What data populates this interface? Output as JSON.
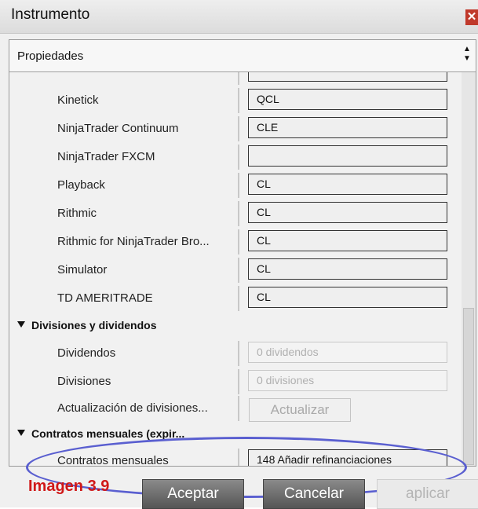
{
  "window": {
    "title": "Instrumento",
    "close_icon": "close-icon"
  },
  "panel": {
    "header": "Propiedades"
  },
  "rows": [
    {
      "label": "Kinetick",
      "value": "QCL"
    },
    {
      "label": "NinjaTrader Continuum",
      "value": "CLE"
    },
    {
      "label": "NinjaTrader FXCM",
      "value": ""
    },
    {
      "label": "Playback",
      "value": "CL"
    },
    {
      "label": "Rithmic",
      "value": "CL"
    },
    {
      "label": "Rithmic for NinjaTrader Bro...",
      "value": "CL"
    },
    {
      "label": "Simulator",
      "value": "CL"
    },
    {
      "label": "TD AMERITRADE",
      "value": "CL"
    }
  ],
  "divisions": {
    "title": "Divisiones y dividendos",
    "dividends_label": "Dividendos",
    "dividends_value": "0 dividendos",
    "splits_label": "Divisiones",
    "splits_value": "0 divisiones",
    "update_label": "Actualización de divisiones...",
    "update_button": "Actualizar"
  },
  "rollovers": {
    "title": "Contratos mensuales (expir...",
    "label": "Contratos mensuales",
    "value": "148 Añadir refinanciaciones"
  },
  "caption": "Imagen 3.9",
  "buttons": {
    "ok": "Aceptar",
    "cancel": "Cancelar",
    "apply": "aplicar"
  },
  "colors": {
    "highlight": "#5a5fd0",
    "caption": "#d01818"
  }
}
